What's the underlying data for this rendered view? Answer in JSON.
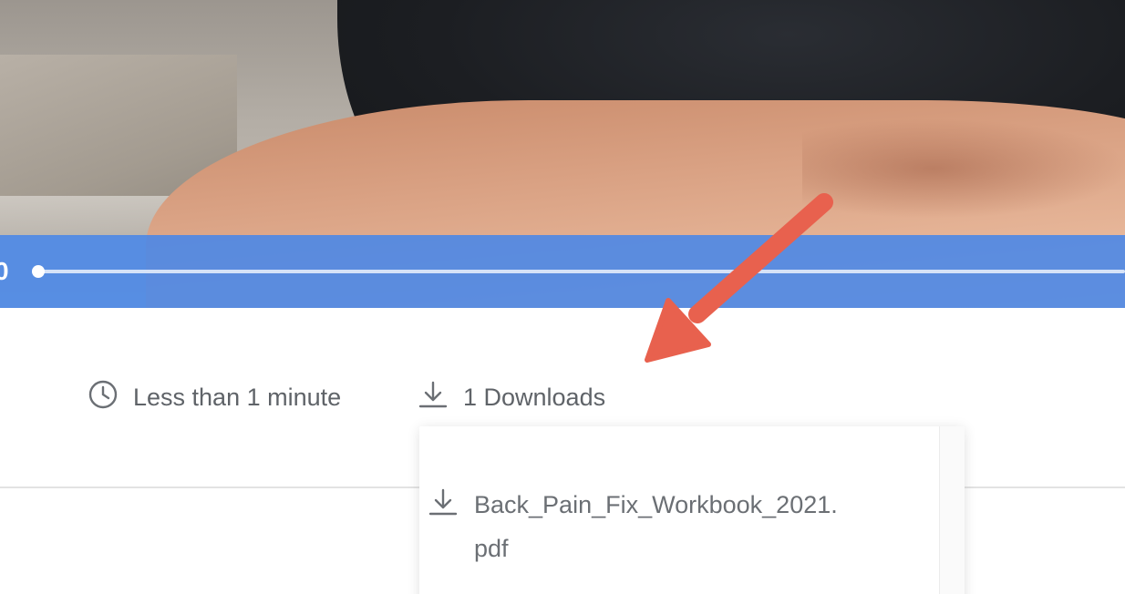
{
  "player": {
    "time_partial": "0",
    "progress_percent": 0
  },
  "meta": {
    "duration_icon": "clock-icon",
    "duration_text": "Less than 1 minute",
    "downloads_icon": "download-icon",
    "downloads_text": "1 Downloads"
  },
  "downloads_panel": {
    "files": [
      {
        "name": "Back_Pain_Fix_Workbook_2021.pdf",
        "icon": "download-icon"
      }
    ]
  },
  "colors": {
    "control_bar": "#4886e8",
    "meta_text": "#5f6368",
    "annotation_arrow": "#e8614e"
  }
}
